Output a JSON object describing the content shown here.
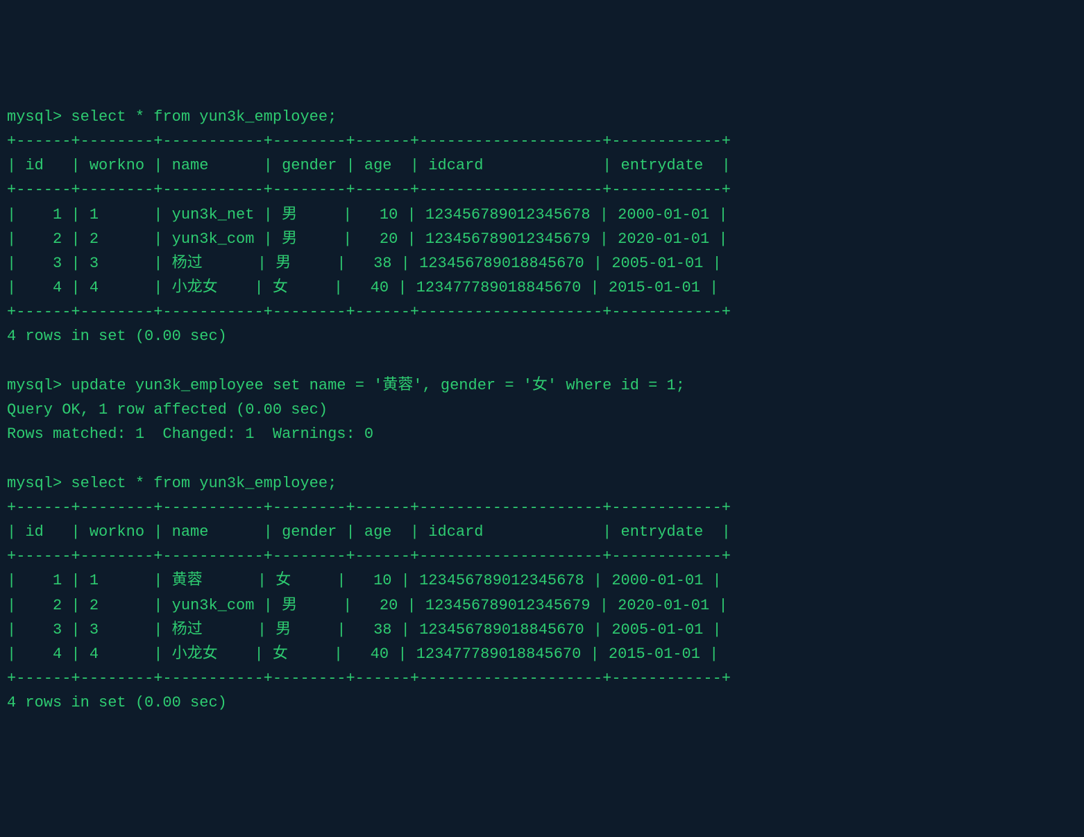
{
  "prompt": "mysql>",
  "query1": "select * from yun3k_employee;",
  "query2": "update yun3k_employee set name = '黄蓉', gender = '女' where id = 1;",
  "query3": "select * from yun3k_employee;",
  "table_separator": "+------+--------+-----------+--------+------+--------------------+------------+",
  "headers": {
    "id": "id",
    "workno": "workno",
    "name": "name",
    "gender": "gender",
    "age": "age",
    "idcard": "idcard",
    "entrydate": "entrydate"
  },
  "table1": {
    "rows": [
      {
        "id": "1",
        "workno": "1",
        "name": "yun3k_net",
        "gender": "男",
        "age": "10",
        "idcard": "123456789012345678",
        "entrydate": "2000-01-01"
      },
      {
        "id": "2",
        "workno": "2",
        "name": "yun3k_com",
        "gender": "男",
        "age": "20",
        "idcard": "123456789012345679",
        "entrydate": "2020-01-01"
      },
      {
        "id": "3",
        "workno": "3",
        "name": "杨过",
        "gender": "男",
        "age": "38",
        "idcard": "123456789018845670",
        "entrydate": "2005-01-01"
      },
      {
        "id": "4",
        "workno": "4",
        "name": "小龙女",
        "gender": "女",
        "age": "40",
        "idcard": "123477789018845670",
        "entrydate": "2015-01-01"
      }
    ]
  },
  "table2": {
    "rows": [
      {
        "id": "1",
        "workno": "1",
        "name": "黄蓉",
        "gender": "女",
        "age": "10",
        "idcard": "123456789012345678",
        "entrydate": "2000-01-01"
      },
      {
        "id": "2",
        "workno": "2",
        "name": "yun3k_com",
        "gender": "男",
        "age": "20",
        "idcard": "123456789012345679",
        "entrydate": "2020-01-01"
      },
      {
        "id": "3",
        "workno": "3",
        "name": "杨过",
        "gender": "男",
        "age": "38",
        "idcard": "123456789018845670",
        "entrydate": "2005-01-01"
      },
      {
        "id": "4",
        "workno": "4",
        "name": "小龙女",
        "gender": "女",
        "age": "40",
        "idcard": "123477789018845670",
        "entrydate": "2015-01-01"
      }
    ]
  },
  "rows_in_set": "4 rows in set (0.00 sec)",
  "update_result1": "Query OK, 1 row affected (0.00 sec)",
  "update_result2": "Rows matched: 1  Changed: 1  Warnings: 0"
}
